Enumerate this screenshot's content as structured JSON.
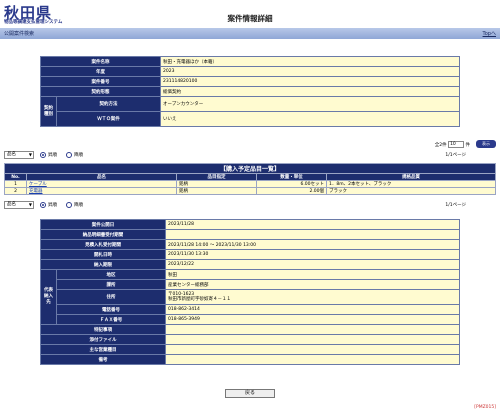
{
  "header": {
    "logo_main": "秋田県",
    "logo_sub": "物品等調達支払管理システム",
    "page_title": "案件情報詳細"
  },
  "titlebar": {
    "left": "公開案件検索",
    "right": "Topへ"
  },
  "case_info": {
    "name_label": "案件名称",
    "name": "秋田・充電器ほか（本籍）",
    "year_label": "年度",
    "year": "2023",
    "number_label": "案件番号",
    "number": "231114820100",
    "category_label": "契約形態",
    "category": "総価契約",
    "group_label": "契約種別",
    "method_label": "契約方法",
    "method": "オープンカウンター",
    "wto_label": "ＷＴＯ案件",
    "wto": "いいえ"
  },
  "sort1": {
    "select": "品名",
    "asc": "昇順",
    "desc": "降順",
    "page": "1/1ページ"
  },
  "count": {
    "total": "全2件",
    "per_page": "10",
    "unit": "件",
    "button": "表示"
  },
  "items": {
    "caption": "【購入予定品目一覧】",
    "headers": [
      "No.",
      "品名",
      "品目指定",
      "数量・単位",
      "規格品質"
    ],
    "rows": [
      {
        "no": "1",
        "name": "ケーブル",
        "spec": "銘柄",
        "qty": "6.00セット",
        "quality": "1．8m、2本セット、ブラック"
      },
      {
        "no": "2",
        "name": "充電器",
        "spec": "銘柄",
        "qty": "2.00個",
        "quality": "ブラック"
      }
    ]
  },
  "sort2": {
    "select": "品名",
    "asc": "昇順",
    "desc": "降順",
    "page": "1/1ページ"
  },
  "schedule": {
    "publish_label": "案件公開日",
    "publish": "2023/11/28",
    "deliver_label": "納品明細書受付期間",
    "deliver": "",
    "quote_label": "見積入札受付期間",
    "quote": "2023/11/28 14:00 ～ 2023/11/30 13:00",
    "open_label": "開札日時",
    "open": "2023/11/30 13:30",
    "due_label": "納入期限",
    "due": "2023/12/22",
    "group_label": "代表納入先",
    "area_label": "地区",
    "area": "秋田",
    "dept_label": "課所",
    "dept": "産業センター総務部",
    "addr_label": "住所",
    "zip": "〒010-1623",
    "addr": "秋田市新屋町字砂奴寄４－１１",
    "tel_label": "電話番号",
    "tel": "018-862-3414",
    "fax_label": "ＦＡＸ番号",
    "fax": "018-865-3949",
    "note_label": "特記事項",
    "note": "",
    "file_label": "添付ファイル",
    "file": "",
    "tender_label": "主な営業種目",
    "tender": "",
    "remark_label": "備考",
    "remark": ""
  },
  "back_button": "戻る",
  "footer_code": "[PMZ015]"
}
